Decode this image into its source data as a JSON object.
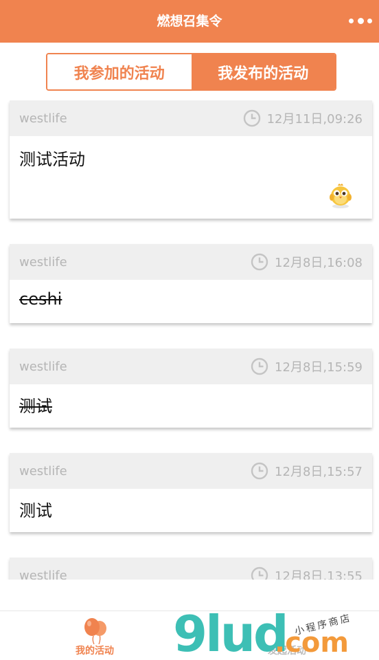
{
  "navbar": {
    "title": "燃想召集令"
  },
  "segment": {
    "tab_joined": "我参加的活动",
    "tab_published": "我发布的活动"
  },
  "activities": [
    {
      "user": "westlife",
      "time": "12月11日,09:26",
      "title": "测试活动"
    },
    {
      "user": "westlife",
      "time": "12月8日,16:08",
      "title": "ceshi"
    },
    {
      "user": "westlife",
      "time": "12月8日,15:59",
      "title": "测试"
    },
    {
      "user": "westlife",
      "time": "12月8日,15:57",
      "title": "测试"
    },
    {
      "user": "westlife",
      "time": "12月8日,13:55",
      "title": ""
    }
  ],
  "tabbar": {
    "my_activities": "我的活动",
    "publish_activity": "发起活动"
  },
  "watermark": {
    "brand": "9lud",
    "domain": ".com",
    "tagline": "小程序商店"
  },
  "colors": {
    "accent": "#f0834f",
    "header_bg": "#efefef",
    "meta_text": "#b5b5b5"
  }
}
